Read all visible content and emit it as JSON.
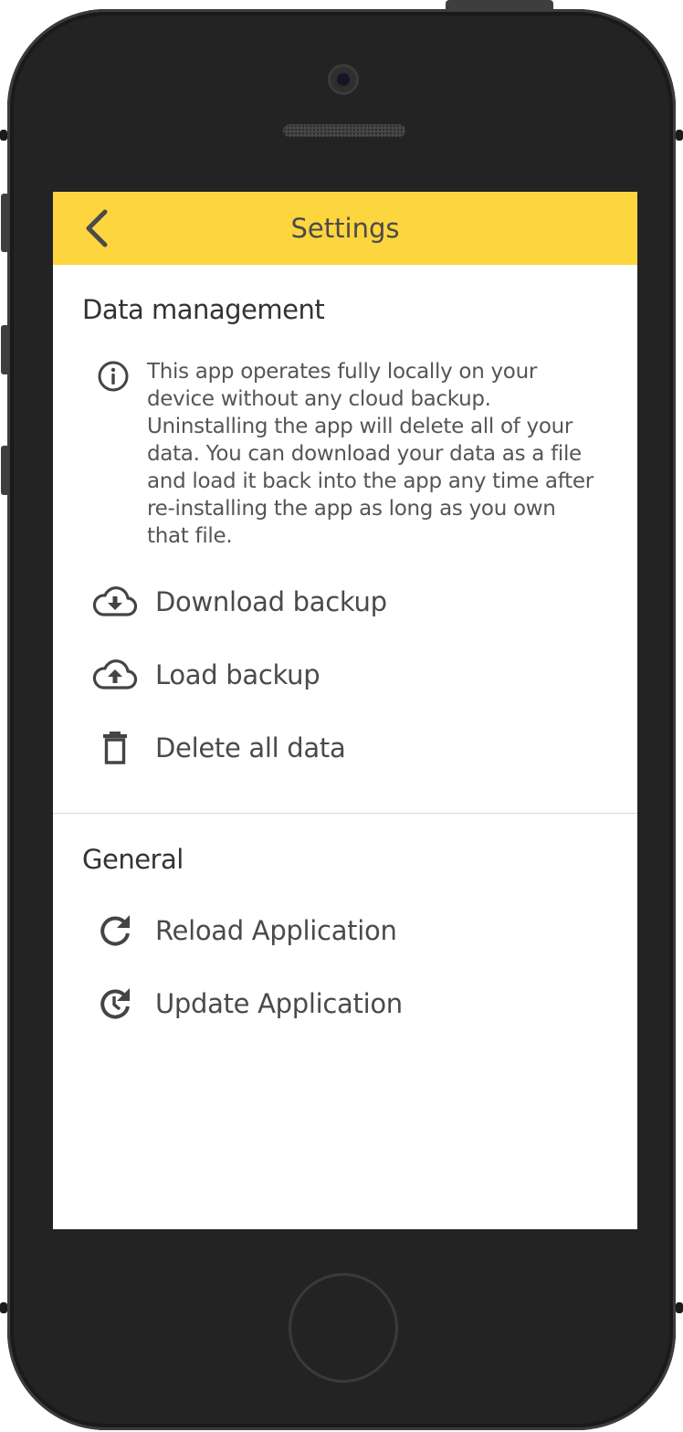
{
  "appbar": {
    "title": "Settings",
    "background": "#fdd53f",
    "back_icon": "chevron-left-icon"
  },
  "data_management": {
    "title": "Data management",
    "info_icon": "info-circle-icon",
    "info_text": "This app operates fully locally on your device without any cloud backup. Uninstalling the app will delete all of your data. You can download your data as a file and load it back into the app any time after re-installing the app as long as you own that file.",
    "items": [
      {
        "label": "Download backup",
        "icon": "cloud-download-icon"
      },
      {
        "label": "Load backup",
        "icon": "cloud-upload-icon"
      },
      {
        "label": "Delete all data",
        "icon": "trash-icon"
      }
    ]
  },
  "general": {
    "title": "General",
    "items": [
      {
        "label": "Reload Application",
        "icon": "reload-icon"
      },
      {
        "label": "Update Application",
        "icon": "update-clock-icon"
      }
    ]
  }
}
